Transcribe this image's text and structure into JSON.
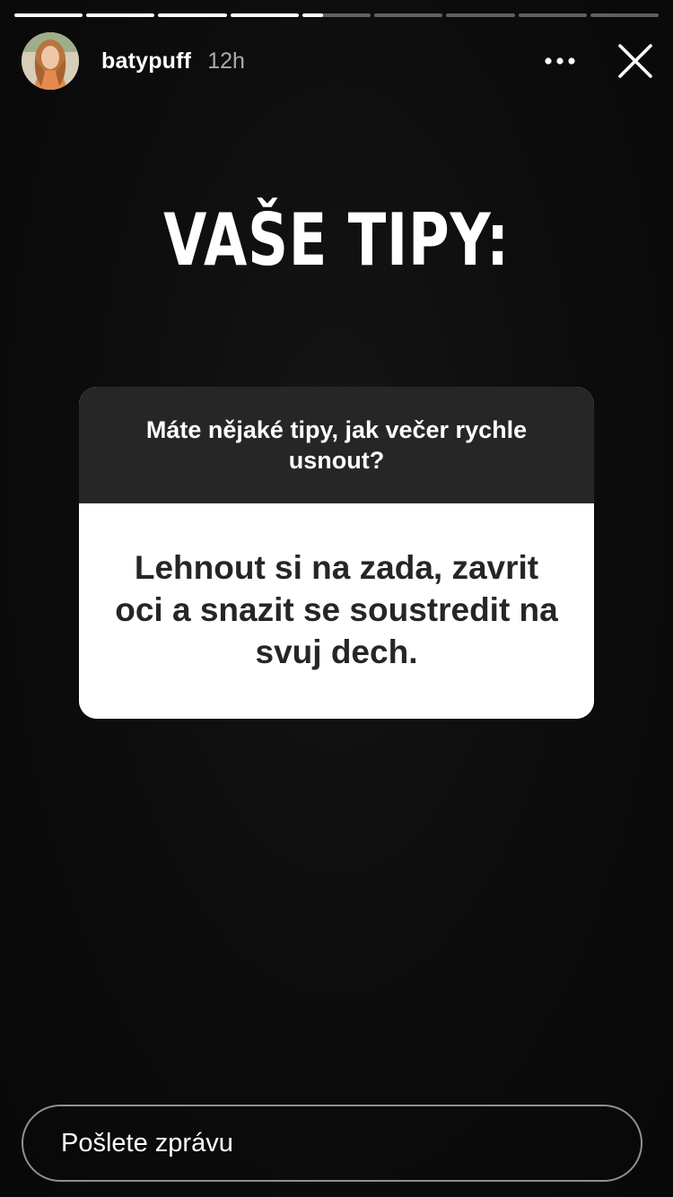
{
  "story": {
    "segments": 9,
    "progress": [
      1,
      1,
      1,
      1,
      0.3,
      0,
      0,
      0,
      0
    ]
  },
  "header": {
    "username": "batypuff",
    "timestamp": "12h",
    "more_icon": "more-horizontal-icon",
    "close_icon": "close-icon",
    "avatar_icon": "avatar-photo"
  },
  "content": {
    "headline": "VAŠE TIPY:",
    "question": "Máte nějaké tipy, jak večer rychle usnout?",
    "answer": "Lehnout si na zada, zavrit oci a snazit se soustredit na svuj dech."
  },
  "reply": {
    "placeholder": "Pošlete zprávu"
  },
  "colors": {
    "background": "#0b0b0b",
    "question_bg": "#262626",
    "answer_bg": "#ffffff",
    "answer_text": "#262626"
  }
}
